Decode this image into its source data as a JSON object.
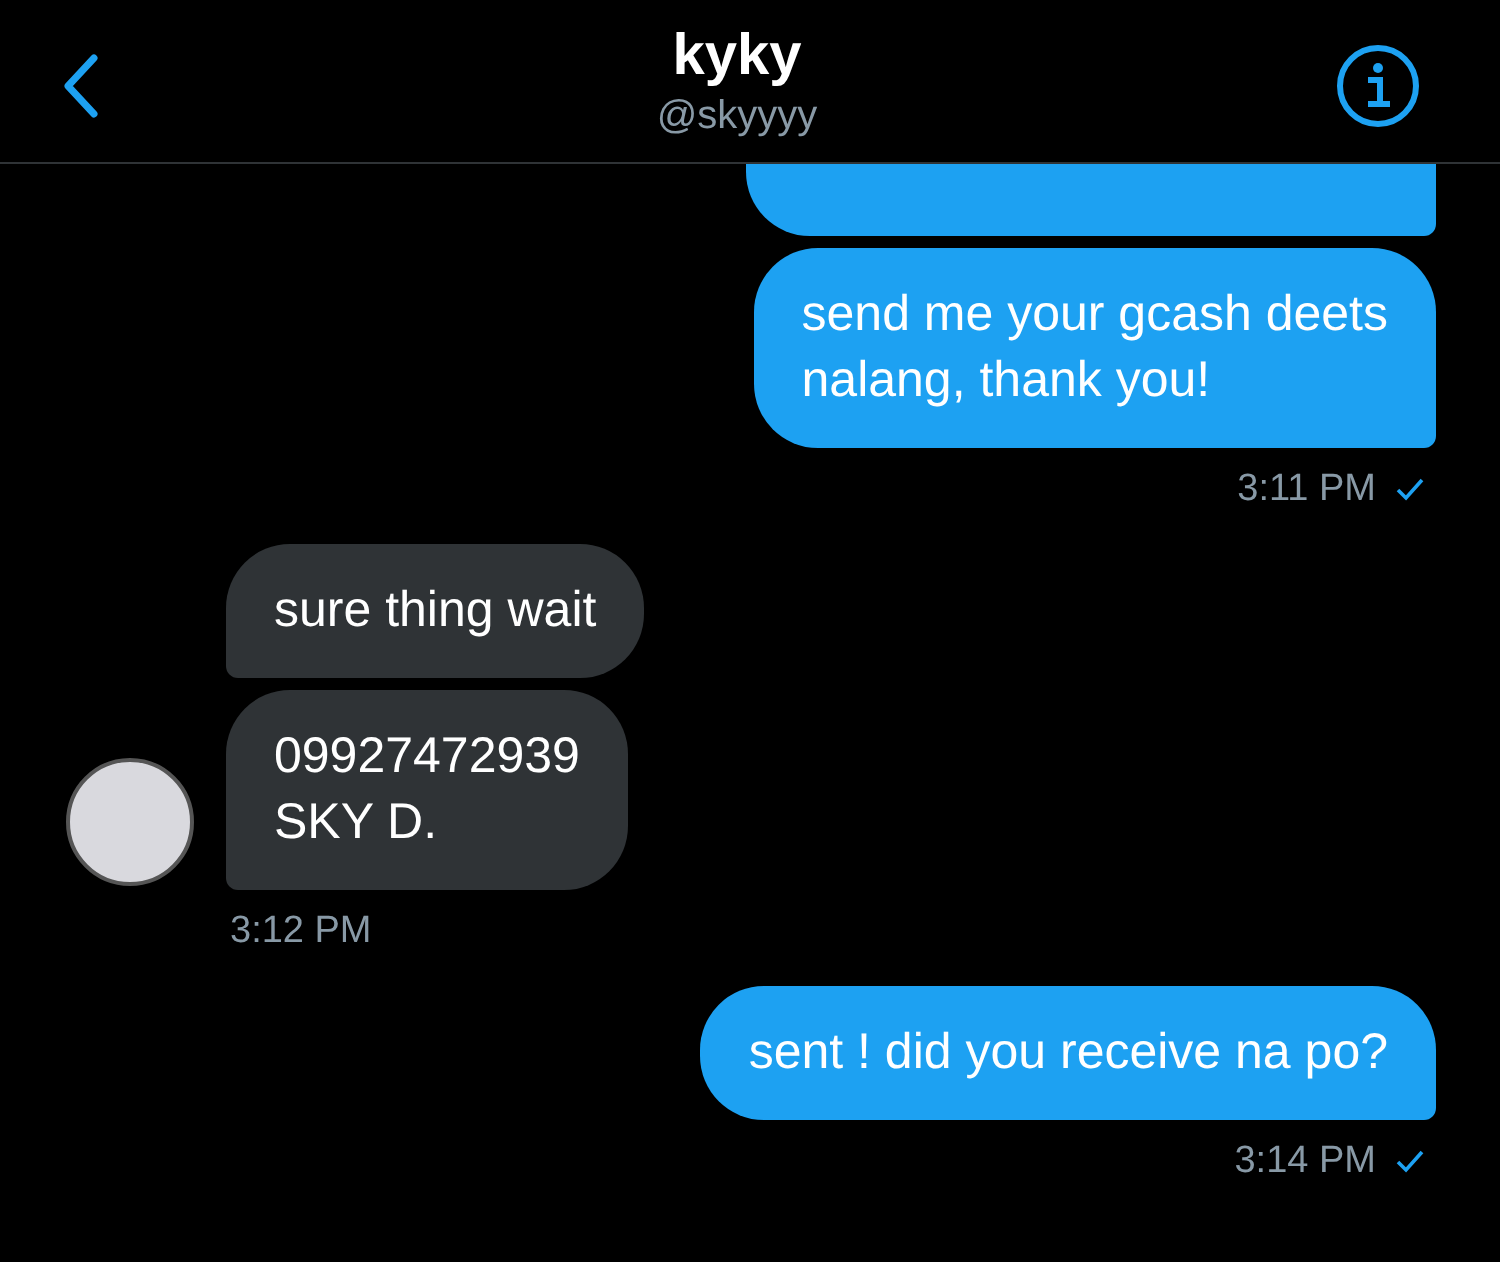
{
  "header": {
    "title": "kyky",
    "handle": "@skyyyy"
  },
  "groups": [
    {
      "kind": "outgoing",
      "bubbles": [
        {
          "partial": true
        },
        {
          "text": "send me your gcash deets\nnalang, thank you!"
        }
      ],
      "time": "3:11 PM",
      "seen": true
    },
    {
      "kind": "incoming",
      "bubbles": [
        {
          "text": "sure thing wait"
        },
        {
          "text": "09927472939\nSKY D."
        }
      ],
      "time": "3:12 PM"
    },
    {
      "kind": "outgoing",
      "bubbles": [
        {
          "text": "sent ! did you receive na po?"
        }
      ],
      "time": "3:14 PM",
      "seen": true
    }
  ]
}
